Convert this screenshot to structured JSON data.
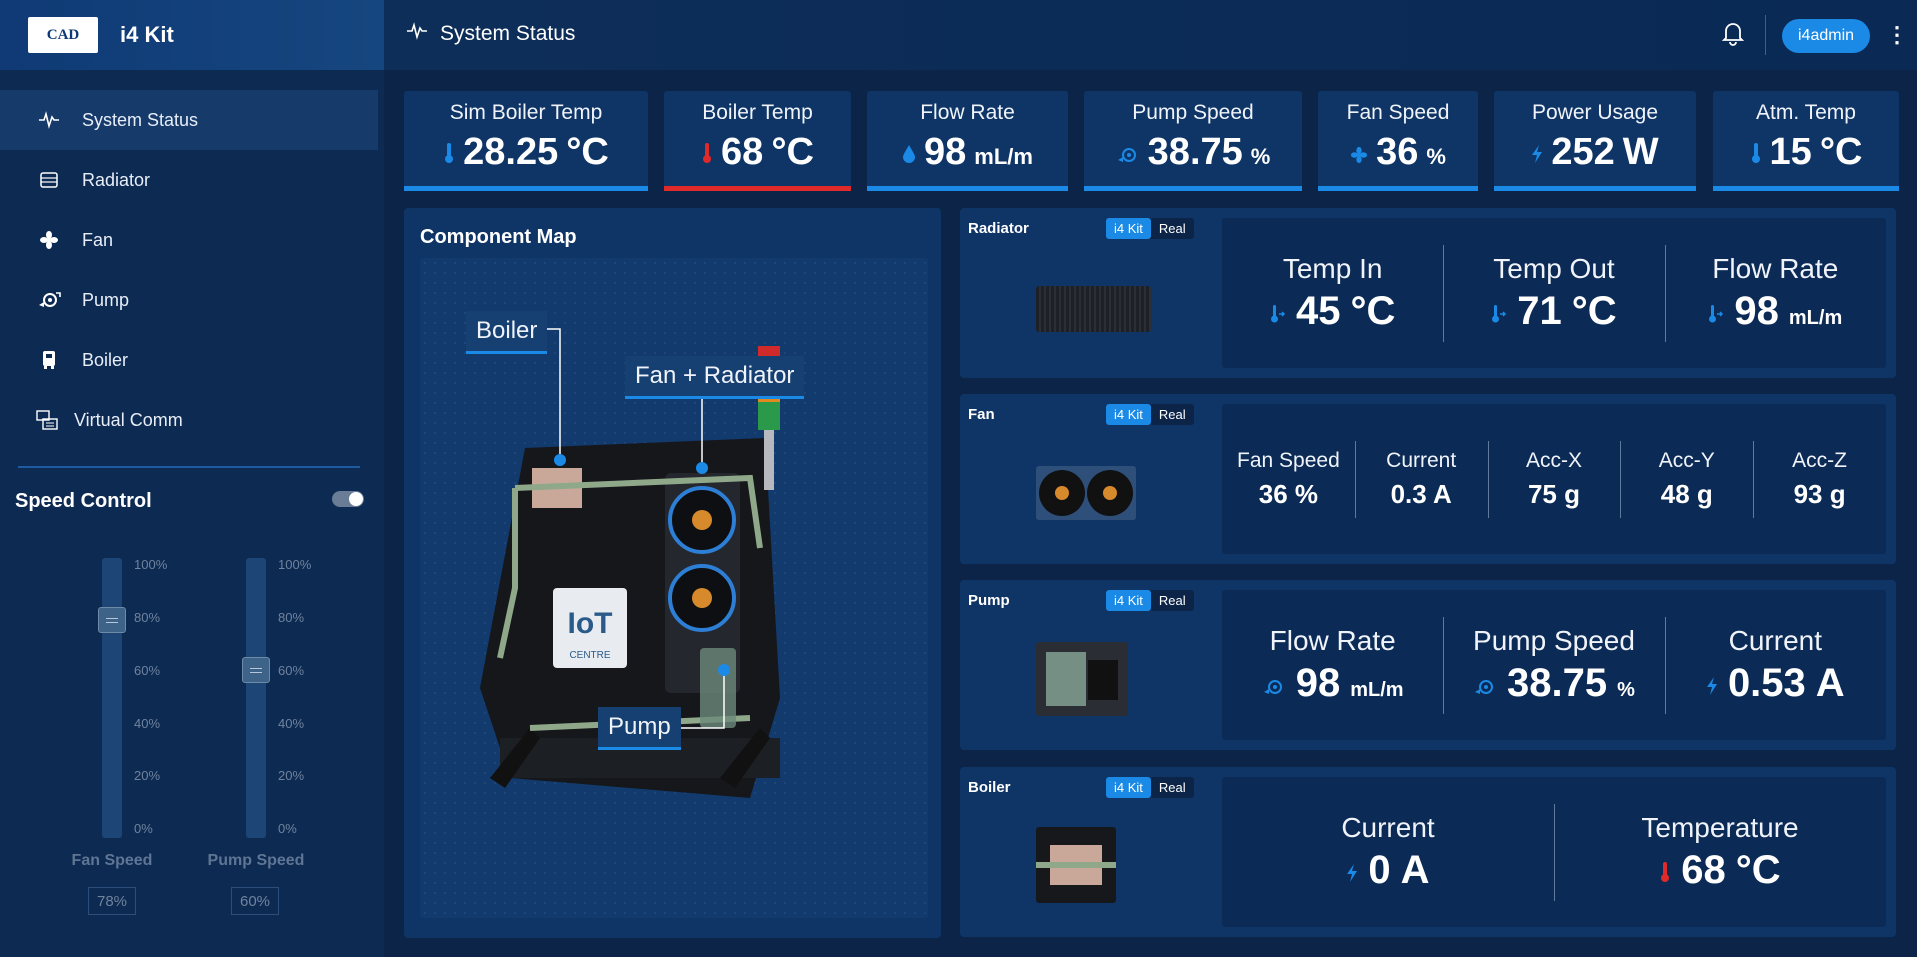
{
  "app": {
    "logo_text": "CAD",
    "name": "i4 Kit"
  },
  "header": {
    "title": "System Status",
    "user": "i4admin",
    "menu_glyph": "⋮"
  },
  "sidebar": {
    "items": [
      {
        "label": "System Status",
        "icon": "pulse-icon"
      },
      {
        "label": "Radiator",
        "icon": "radiator-icon"
      },
      {
        "label": "Fan",
        "icon": "fan-icon"
      },
      {
        "label": "Pump",
        "icon": "pump-icon"
      },
      {
        "label": "Boiler",
        "icon": "boiler-icon"
      },
      {
        "label": "Virtual Comm",
        "icon": "comm-icon"
      }
    ],
    "speed_control": {
      "title": "Speed Control",
      "ticks": [
        "100%",
        "80%",
        "60%",
        "40%",
        "20%",
        "0%"
      ],
      "fan": {
        "label": "Fan Speed",
        "value": "78%",
        "level": 0.78
      },
      "pump": {
        "label": "Pump Speed",
        "value": "60%",
        "level": 0.6
      }
    }
  },
  "stats": [
    {
      "label": "Sim Boiler Temp",
      "value": "28.25",
      "unit": "°C",
      "icon": "thermometer-icon"
    },
    {
      "label": "Boiler Temp",
      "value": "68",
      "unit": "°C",
      "icon": "thermometer-hot-icon"
    },
    {
      "label": "Flow Rate",
      "value": "98",
      "unit": "mL/m",
      "icon": "droplet-icon"
    },
    {
      "label": "Pump Speed",
      "value": "38.75",
      "unit": "%",
      "icon": "pump-icon"
    },
    {
      "label": "Fan Speed",
      "value": "36",
      "unit": "%",
      "icon": "fan-icon"
    },
    {
      "label": "Power Usage",
      "value": "252",
      "unit": "W",
      "icon": "bolt-icon"
    },
    {
      "label": "Atm. Temp",
      "value": "15",
      "unit": "°C",
      "icon": "thermometer-icon"
    }
  ],
  "component_map": {
    "title": "Component Map",
    "callouts": {
      "boiler": "Boiler",
      "fan_radiator": "Fan + Radiator",
      "pump": "Pump"
    },
    "badge": {
      "line1": "IoT",
      "line2": "CENTRE"
    }
  },
  "toggle": {
    "kit": "i4 Kit",
    "real": "Real"
  },
  "cards": {
    "radiator": {
      "name": "Radiator",
      "metrics": [
        {
          "label": "Temp In",
          "value": "45",
          "unit": "°C"
        },
        {
          "label": "Temp Out",
          "value": "71",
          "unit": "°C"
        },
        {
          "label": "Flow Rate",
          "value": "98",
          "unit": "mL/m"
        }
      ]
    },
    "fan": {
      "name": "Fan",
      "metrics": [
        {
          "label": "Fan Speed",
          "value": "36 %"
        },
        {
          "label": "Current",
          "value": "0.3 A"
        },
        {
          "label": "Acc-X",
          "value": "75 g"
        },
        {
          "label": "Acc-Y",
          "value": "48 g"
        },
        {
          "label": "Acc-Z",
          "value": "93 g"
        }
      ]
    },
    "pump": {
      "name": "Pump",
      "metrics": [
        {
          "label": "Flow Rate",
          "value": "98",
          "unit": "mL/m"
        },
        {
          "label": "Pump Speed",
          "value": "38.75",
          "unit": "%"
        },
        {
          "label": "Current",
          "value": "0.53",
          "unit": "A"
        }
      ]
    },
    "boiler": {
      "name": "Boiler",
      "metrics": [
        {
          "label": "Current",
          "value": "0",
          "unit": "A"
        },
        {
          "label": "Temperature",
          "value": "68",
          "unit": "°C"
        }
      ]
    }
  },
  "colors": {
    "accent": "#1a8ae6",
    "alert": "#e02a2a",
    "panel": "#0f3566",
    "background": "#0b2447"
  }
}
